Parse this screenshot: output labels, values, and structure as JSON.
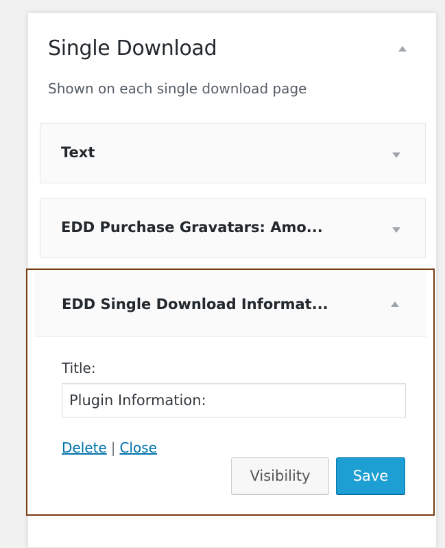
{
  "sidebar": {
    "title": "Single Download",
    "description": "Shown on each single download page",
    "toggle_icon": "arrow-up-icon"
  },
  "widgets": [
    {
      "title": "Text",
      "expanded": false,
      "toggle_icon": "arrow-down-icon"
    },
    {
      "title": "EDD Purchase Gravatars: Amo...",
      "expanded": false,
      "toggle_icon": "arrow-down-icon"
    },
    {
      "title": "EDD Single Download Informat...",
      "expanded": true,
      "toggle_icon": "arrow-up-icon",
      "form": {
        "title_label": "Title:",
        "title_value": "Plugin Information:"
      },
      "actions": {
        "delete_label": "Delete",
        "separator": "|",
        "close_label": "Close",
        "visibility_label": "Visibility",
        "save_label": "Save"
      }
    }
  ],
  "colors": {
    "highlight_border": "#7a3b12",
    "save_button": "#1e9fd3",
    "link": "#0073aa"
  }
}
